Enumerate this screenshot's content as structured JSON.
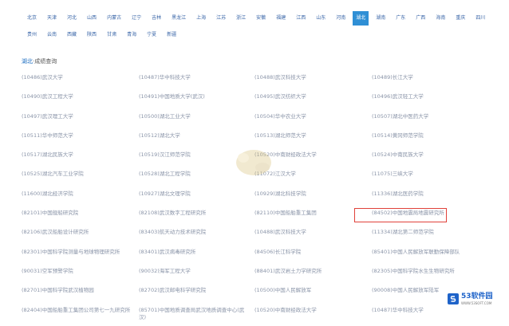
{
  "provinces": {
    "row1": [
      "北京",
      "天津",
      "河北",
      "山西",
      "内蒙古",
      "辽宁",
      "吉林",
      "黑龙江",
      "上海",
      "江苏",
      "浙江",
      "安徽",
      "福建",
      "江西",
      "山东",
      "河南",
      "湖北",
      "湖南",
      "广东",
      "广西",
      "海南",
      "重庆",
      "四川"
    ],
    "row2": [
      "贵州",
      "云南",
      "西藏",
      "陕西",
      "甘肃",
      "青海",
      "宁夏",
      "新疆"
    ],
    "active": "湖北"
  },
  "section": {
    "province": "湖北",
    "title": "成绩查询"
  },
  "schools": [
    [
      "(10486)武汉大学",
      "(10487)华中科技大学",
      "(10488)武汉科技大学",
      "(10489)长江大学"
    ],
    [
      "(10490)武汉工程大学",
      "(10491)中国地质大学(武汉)",
      "(10495)武汉纺织大学",
      "(10496)武汉轻工大学"
    ],
    [
      "(10497)武汉理工大学",
      "(10500)湖北工业大学",
      "(10504)华中农业大学",
      "(10507)湖北中医药大学"
    ],
    [
      "(10511)华中师范大学",
      "(10512)湖北大学",
      "(10513)湖北师范大学",
      "(10514)黄冈师范学院"
    ],
    [
      "(10517)湖北民族大学",
      "(10519)汉江师范学院",
      "(10520)中南财经政法大学",
      "(10524)中南民族大学"
    ],
    [
      "(10525)湖北汽车工业学院",
      "(10528)湖北工程学院",
      "(11072)江汉大学",
      "(11075)三峡大学"
    ],
    [
      "(11600)湖北经济学院",
      "(10927)湖北文理学院",
      "(10929)湖北科技学院",
      "(11336)湖北医药学院"
    ],
    [
      "(82101)中国舰船研究院",
      "(82108)武汉数字工程研究所",
      "(82110)中国船舶重工集团",
      "(84502)中国地震局地震研究所"
    ],
    [
      "(82106)武汉船舶设计研究所",
      "(83403)航天动力技术研究院",
      "(10488)武汉科技大学",
      "(11334)湖北第二师范学院"
    ],
    [
      "(82301)中国科学院测量与地球物理研究所",
      "(83401)武汉病毒研究所",
      "(84506)长江科学院",
      "(85401)中国人民解放军联勤保障部队"
    ],
    [
      "(90031)空军预警学院",
      "(90032)海军工程大学",
      "(88401)武汉岩土力学研究所",
      "(82305)中国科学院水生生物研究所"
    ],
    [
      "(82701)中国科学院武汉植物园",
      "(82702)武汉邮电科学研究院",
      "(10500)中国人民解放军",
      "(90008)中国人民解放军陆军"
    ],
    [
      "(82404)中国船舶重工集团公司第七一九研究所",
      "(85701)中国地质调查局武汉地质调查中心(武汉)",
      "(10520)中南财经政法大学",
      "(10487)华中科技大学"
    ]
  ],
  "highlighted_school": "(10488)武汉科技大学",
  "logo": {
    "text": "53软件园",
    "sub": "WWW.53SOFT.COM"
  },
  "colors": {
    "active_tab": "#2f8fd5",
    "link": "#1f5aa6",
    "highlight_border": "#e0413a",
    "logo": "#1e63c9"
  }
}
